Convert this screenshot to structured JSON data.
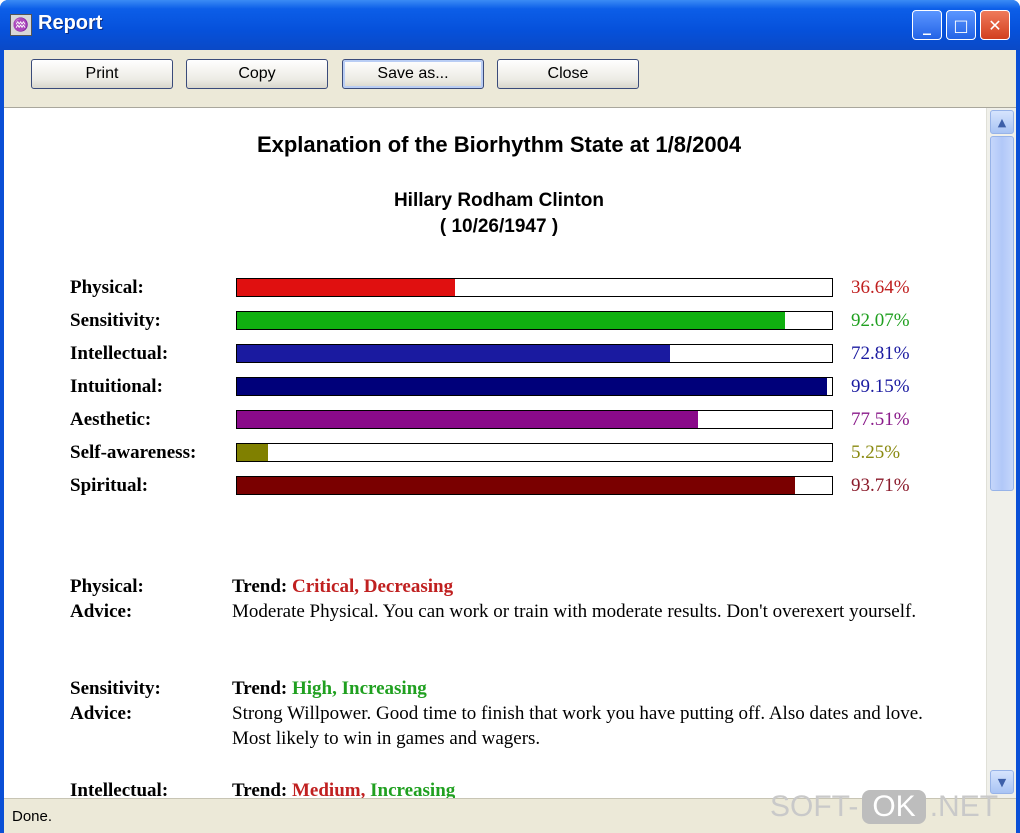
{
  "window": {
    "title": "Report"
  },
  "toolbar": {
    "print": "Print",
    "copy": "Copy",
    "save_as": "Save as...",
    "close": "Close"
  },
  "report": {
    "title": "Explanation of the Biorhythm State at 1/8/2004",
    "name": "Hillary Rodham Clinton",
    "dob": "( 10/26/1947 )"
  },
  "bars": [
    {
      "label": "Physical:",
      "value": 36.64,
      "value_text": "36.64%",
      "color": "#e01010",
      "text_color": "#c02020"
    },
    {
      "label": "Sensitivity:",
      "value": 92.07,
      "value_text": "92.07%",
      "color": "#10b010",
      "text_color": "#20a020"
    },
    {
      "label": "Intellectual:",
      "value": 72.81,
      "value_text": "72.81%",
      "color": "#1a1aa0",
      "text_color": "#1a1aa0"
    },
    {
      "label": "Intuitional:",
      "value": 99.15,
      "value_text": "99.15%",
      "color": "#00007a",
      "text_color": "#1a1aa0"
    },
    {
      "label": "Aesthetic:",
      "value": 77.51,
      "value_text": "77.51%",
      "color": "#8a0a8a",
      "text_color": "#8a1a8a"
    },
    {
      "label": "Self-awareness:",
      "value": 5.25,
      "value_text": "5.25%",
      "color": "#808000",
      "text_color": "#8a8a10"
    },
    {
      "label": "Spiritual:",
      "value": 93.71,
      "value_text": "93.71%",
      "color": "#7a0000",
      "text_color": "#8a1a2a"
    }
  ],
  "advice": [
    {
      "category": "Physical:",
      "advice_label": "Advice:",
      "trend_label": "Trend:",
      "trend_parts": [
        {
          "text": "Critical, Decreasing",
          "color": "#c02020"
        }
      ],
      "text": "Moderate Physical. You can work or train with moderate results. Don't overexert yourself."
    },
    {
      "category": "Sensitivity:",
      "advice_label": "Advice:",
      "trend_label": "Trend:",
      "trend_parts": [
        {
          "text": "High, Increasing",
          "color": "#20a020"
        }
      ],
      "text": "Strong Willpower. Good time to finish that work you have putting off. Also dates and love. Most likely to win in games and wagers."
    },
    {
      "category": "Intellectual:",
      "advice_label": "Advice:",
      "trend_label": "Trend:",
      "trend_parts": [
        {
          "text": "Medium,",
          "color": "#c02020"
        },
        {
          "text": " Increasing",
          "color": "#20a020"
        }
      ],
      "text": ""
    }
  ],
  "status": {
    "text": "Done."
  },
  "watermark": {
    "left": "SOFT-",
    "mid": "OK",
    "right": ".NET"
  }
}
